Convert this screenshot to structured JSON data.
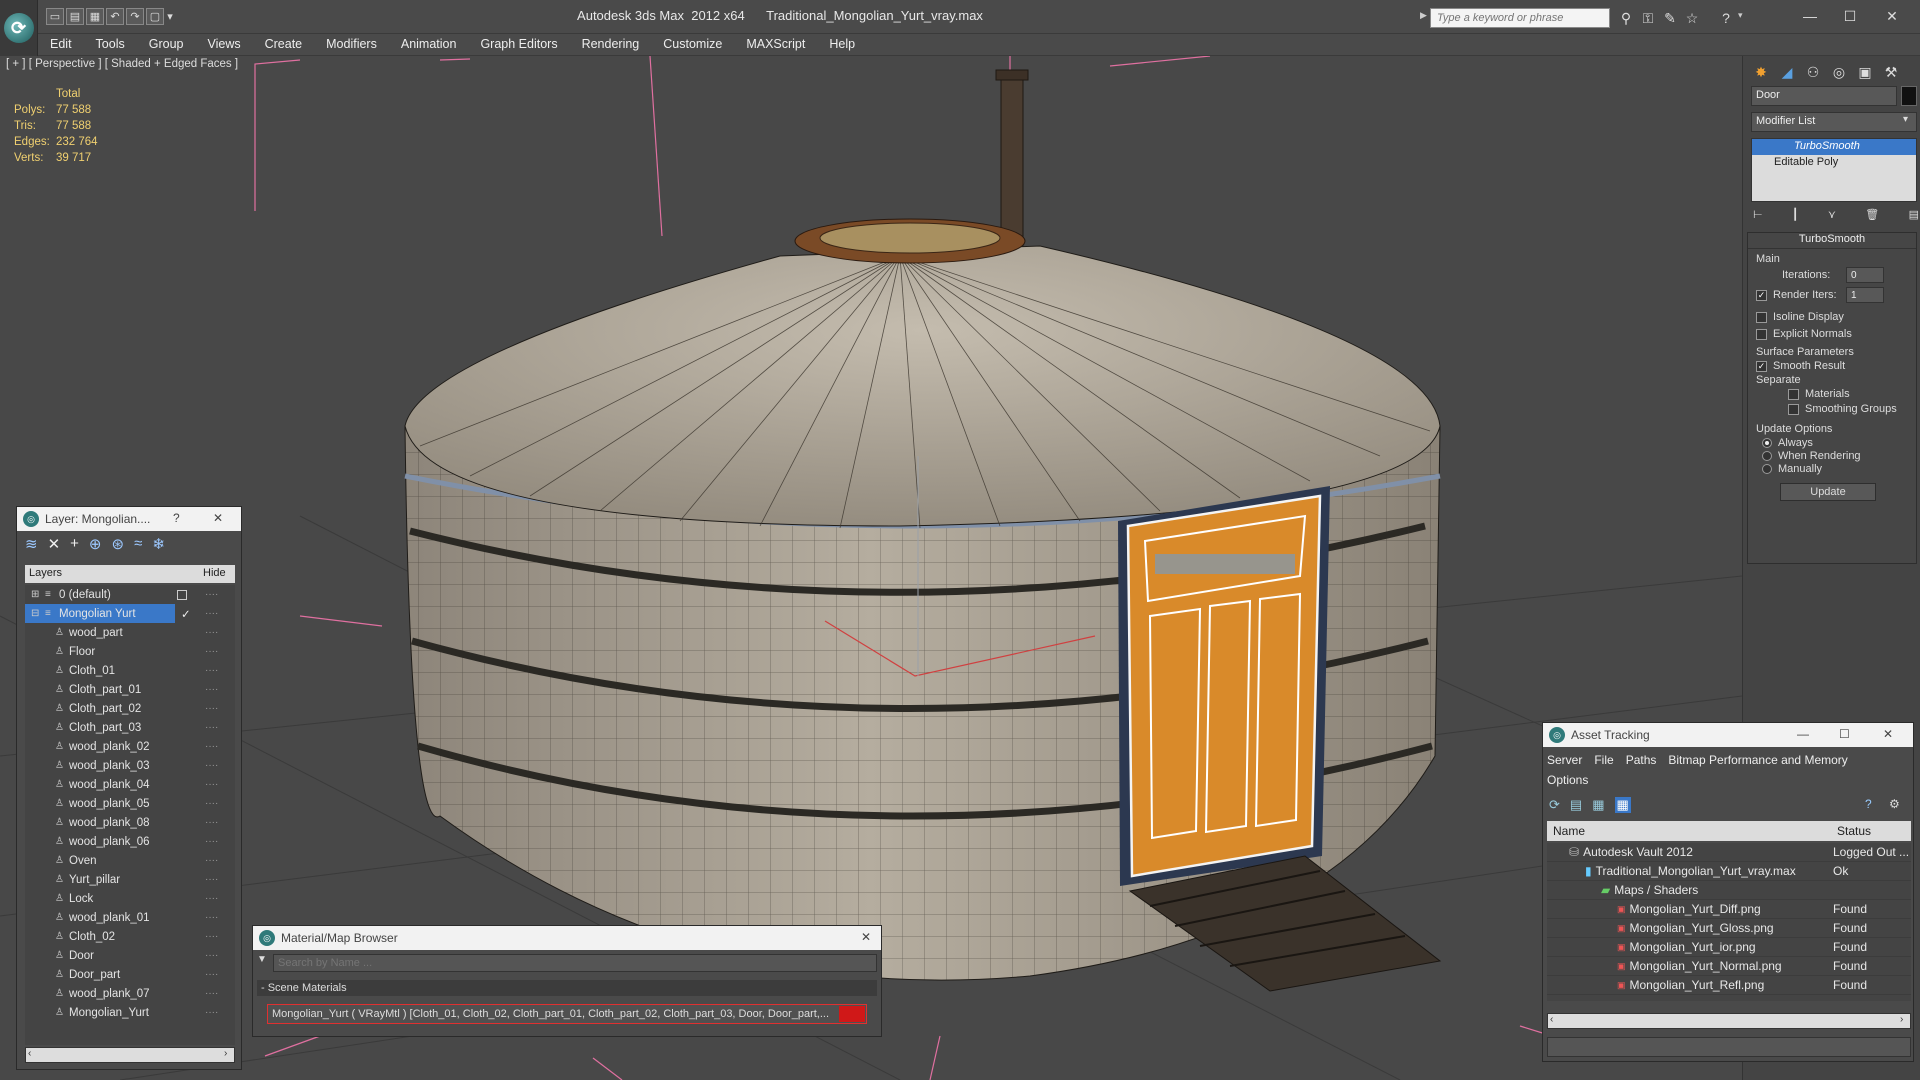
{
  "window": {
    "title": "Autodesk 3ds Max  2012 x64      Traditional_Mongolian_Yurt_vray.max",
    "search_placeholder": "Type a keyword or phrase",
    "min_label": "—",
    "max_label": "☐",
    "close_label": "✕"
  },
  "menu": [
    "Edit",
    "Tools",
    "Group",
    "Views",
    "Create",
    "Modifiers",
    "Animation",
    "Graph Editors",
    "Rendering",
    "Customize",
    "MAXScript",
    "Help"
  ],
  "viewport": {
    "label": "[ + ] [ Perspective ] [ Shaded + Edged Faces ]",
    "stats": {
      "header": "Total",
      "polys_label": "Polys:",
      "polys": "77 588",
      "tris_label": "Tris:",
      "tris": "77 588",
      "edges_label": "Edges:",
      "edges": "232 764",
      "verts_label": "Verts:",
      "verts": "39 717"
    }
  },
  "command_panel": {
    "object_name": "Door",
    "modifier_list": "Modifier List",
    "stack": [
      "TurboSmooth",
      "Editable Poly"
    ],
    "turbosmooth": {
      "title": "TurboSmooth",
      "main": "Main",
      "iterations_label": "Iterations:",
      "iterations": "0",
      "render_iters_label": "Render Iters:",
      "render_iters": "1",
      "isoline": "Isoline Display",
      "explicit_normals": "Explicit Normals",
      "surface_params": "Surface Parameters",
      "smooth_result": "Smooth Result",
      "separate": "Separate",
      "materials": "Materials",
      "smoothing_groups": "Smoothing Groups",
      "update_options": "Update Options",
      "always": "Always",
      "when_rendering": "When Rendering",
      "manually": "Manually",
      "update_btn": "Update"
    }
  },
  "layer_window": {
    "title": "Layer: Mongolian....",
    "help": "?",
    "close": "✕",
    "col_layers": "Layers",
    "col_hide": "Hide",
    "default_layer": "0 (default)",
    "active_layer": "Mongolian Yurt",
    "items": [
      "wood_part",
      "Floor",
      "Cloth_01",
      "Cloth_part_01",
      "Cloth_part_02",
      "Cloth_part_03",
      "wood_plank_02",
      "wood_plank_03",
      "wood_plank_04",
      "wood_plank_05",
      "wood_plank_08",
      "wood_plank_06",
      "Oven",
      "Yurt_pillar",
      "Lock",
      "wood_plank_01",
      "Cloth_02",
      "Door",
      "Door_part",
      "wood_plank_07",
      "Mongolian_Yurt"
    ]
  },
  "material_browser": {
    "title": "Material/Map Browser",
    "close": "✕",
    "search_placeholder": "Search by Name ...",
    "section": "- Scene Materials",
    "entry": "Mongolian_Yurt  ( VRayMtl ) [Cloth_01, Cloth_02, Cloth_part_01, Cloth_part_02, Cloth_part_03, Door, Door_part,..."
  },
  "asset_tracking": {
    "title": "Asset Tracking",
    "menu": [
      "Server",
      "File",
      "Paths",
      "Bitmap Performance and Memory"
    ],
    "menu2": "Options",
    "col_name": "Name",
    "col_status": "Status",
    "rows": [
      {
        "name": "Autodesk Vault 2012",
        "status": "Logged Out ..."
      },
      {
        "name": "Traditional_Mongolian_Yurt_vray.max",
        "status": "Ok"
      },
      {
        "name": "Maps / Shaders",
        "status": ""
      },
      {
        "name": "Mongolian_Yurt_Diff.png",
        "status": "Found"
      },
      {
        "name": "Mongolian_Yurt_Gloss.png",
        "status": "Found"
      },
      {
        "name": "Mongolian_Yurt_ior.png",
        "status": "Found"
      },
      {
        "name": "Mongolian_Yurt_Normal.png",
        "status": "Found"
      },
      {
        "name": "Mongolian_Yurt_Refl.png",
        "status": "Found"
      }
    ]
  },
  "colors": {
    "stats_text": "#f0d070",
    "selection": "#3a78c8",
    "viewport_bg": "#484848",
    "door_orange": "#d98a2a",
    "felt": "#b8b0a4"
  }
}
